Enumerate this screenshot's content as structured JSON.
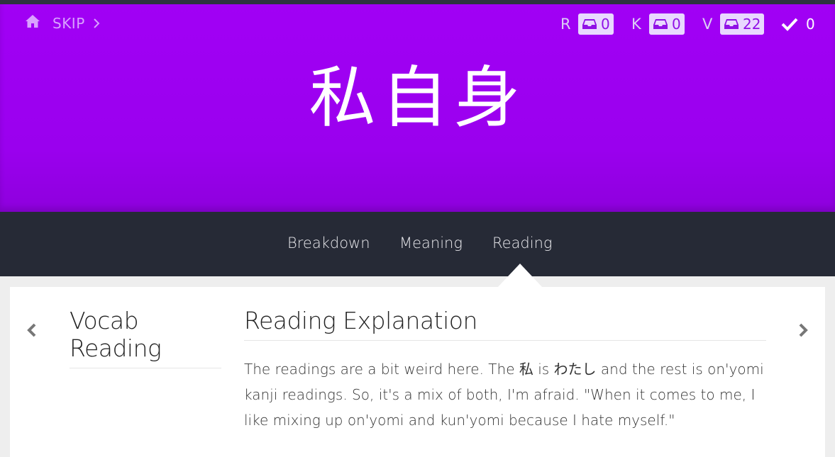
{
  "header": {
    "skip_label": "SKIP",
    "stats": {
      "radicals": {
        "letter": "R",
        "count": "0"
      },
      "kanji": {
        "letter": "K",
        "count": "0"
      },
      "vocabulary": {
        "letter": "V",
        "count": "22"
      },
      "completed": {
        "count": "0"
      }
    },
    "character": "私自身",
    "background_color": "#a000f5"
  },
  "tabs": [
    {
      "label": "Breakdown"
    },
    {
      "label": "Meaning"
    },
    {
      "label": "Reading",
      "active": true
    }
  ],
  "content": {
    "vocab_reading_title": "Vocab Reading",
    "reading_explanation_title": "Reading Explanation",
    "explanation_text": "The readings are a bit weird here. The 私 is わたし and the rest is on'yomi kanji readings. So, it's a mix of both, I'm afraid. \"When it comes to me, I like mixing up on'yomi and kun'yomi because I hate myself.\""
  },
  "icons": {
    "home": "home-icon",
    "skip_chevron": "chevron-right-icon",
    "inbox": "inbox-icon",
    "check": "check-icon",
    "prev": "chevron-left-icon",
    "next": "chevron-right-icon"
  }
}
